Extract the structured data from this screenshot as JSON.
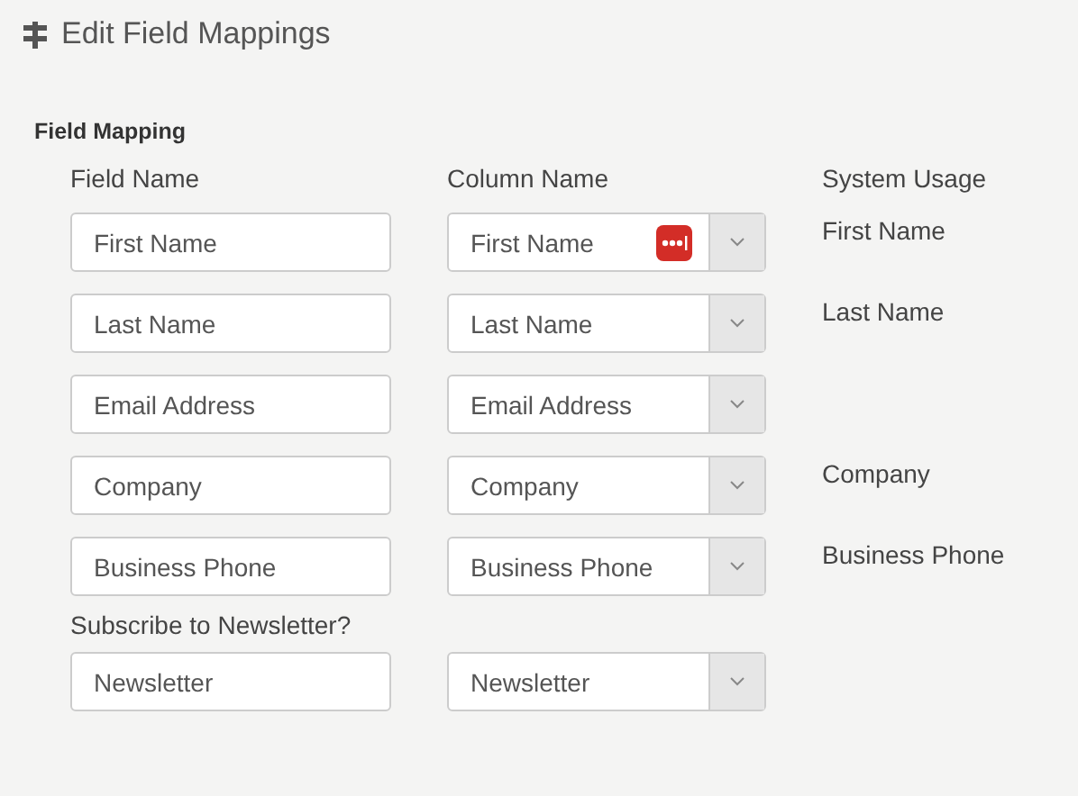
{
  "header": {
    "title": "Edit Field Mappings"
  },
  "section": {
    "title": "Field Mapping",
    "columns": [
      "Field Name",
      "Column Name",
      "System Usage"
    ],
    "rows": [
      {
        "field": "First Name",
        "column": "First Name",
        "usage": "First Name",
        "autofill_badge": true
      },
      {
        "field": "Last Name",
        "column": "Last Name",
        "usage": "Last Name",
        "autofill_badge": false
      },
      {
        "field": "Email Address",
        "column": "Email Address",
        "autofill_badge": false
      },
      {
        "field": "Company",
        "column": "Company",
        "usage": "Company",
        "autofill_badge": false
      },
      {
        "field": "Business Phone",
        "column": "Business Phone",
        "usage": "Business Phone",
        "autofill_badge": false
      },
      {
        "label": "Subscribe to Newsletter?",
        "field": "Newsletter",
        "column": "Newsletter",
        "autofill_badge": false
      }
    ]
  }
}
